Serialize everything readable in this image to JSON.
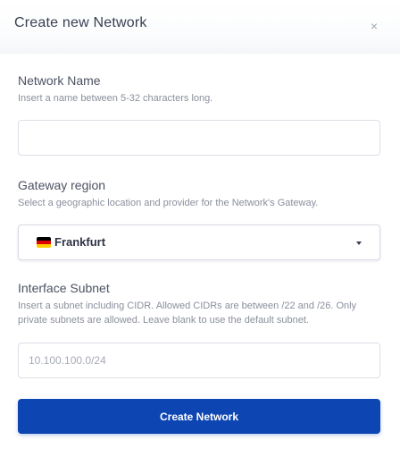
{
  "dialog": {
    "title": "Create new Network",
    "close_icon": "close-icon",
    "close_glyph": "×"
  },
  "fields": {
    "network_name": {
      "label": "Network Name",
      "help": "Insert a name between 5-32 characters long.",
      "value": "",
      "placeholder": ""
    },
    "gateway_region": {
      "label": "Gateway region",
      "help": "Select a geographic location and provider for the Network's Gateway.",
      "selected": "Frankfurt",
      "flag_icon": "germany-flag-icon",
      "caret_icon": "caret-down-icon"
    },
    "interface_subnet": {
      "label": "Interface Subnet",
      "help": "Insert a subnet including CIDR. Allowed CIDRs are between /22 and /26. Only private subnets are allowed. Leave blank to use the default subnet.",
      "value": "",
      "placeholder": "10.100.100.0/24"
    }
  },
  "actions": {
    "submit_label": "Create Network"
  },
  "colors": {
    "primary": "#0d45b3",
    "flag_black": "#000000",
    "flag_red": "#dd0000",
    "flag_gold": "#ffce00"
  }
}
